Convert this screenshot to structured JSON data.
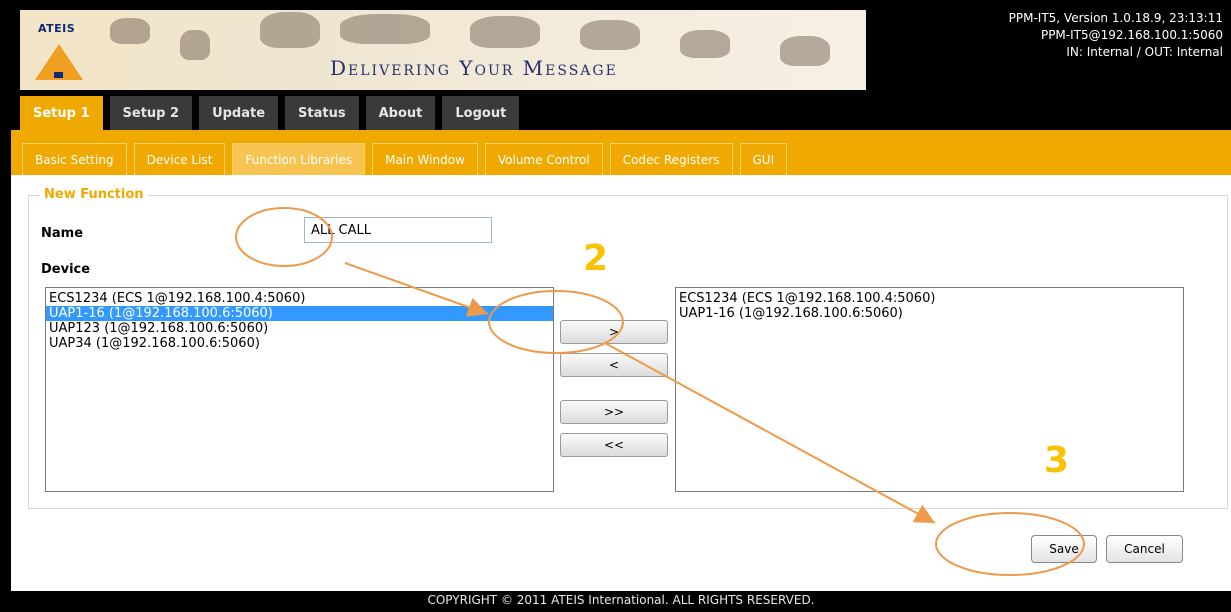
{
  "brand": {
    "logo_text": "ATEIS",
    "slogan": "Delivering Your Message"
  },
  "sysinfo": {
    "line1": "PPM-IT5, Version 1.0.18.9, 23:13:11",
    "line2": "PPM-IT5@192.168.100.1:5060",
    "line3": "IN: Internal / OUT: Internal"
  },
  "top_tabs": [
    "Setup 1",
    "Setup 2",
    "Update",
    "Status",
    "About",
    "Logout"
  ],
  "sub_tabs": [
    "Basic Setting",
    "Device List",
    "Function Libraries",
    "Main Window",
    "Volume Control",
    "Codec Registers",
    "GUI"
  ],
  "form": {
    "legend": "New Function",
    "name_label": "Name",
    "name_value": "ALL CALL",
    "device_label": "Device"
  },
  "available_devices": [
    {
      "label": "ECS1234 (ECS 1@192.168.100.4:5060)",
      "selected": false
    },
    {
      "label": "UAP1-16 (1@192.168.100.6:5060)",
      "selected": true
    },
    {
      "label": "UAP123 (1@192.168.100.6:5060)",
      "selected": false
    },
    {
      "label": "UAP34 (1@192.168.100.6:5060)",
      "selected": false
    }
  ],
  "selected_devices": [
    "ECS1234 (ECS 1@192.168.100.4:5060)",
    "UAP1-16 (1@192.168.100.6:5060)"
  ],
  "move_buttons": {
    "add": ">",
    "remove": "<",
    "add_all": ">>",
    "remove_all": "<<"
  },
  "actions": {
    "save": "Save",
    "cancel": "Cancel"
  },
  "annotations": {
    "step2": "2",
    "step3": "3",
    "color": "#ee9a4a",
    "step_color": "#f7c200"
  },
  "colors": {
    "accent": "#f0a900",
    "tab_inactive": "#3a3a3a",
    "selection": "#3399ff"
  },
  "footer": "COPYRIGHT © 2011 ATEIS International. ALL RIGHTS RESERVED."
}
